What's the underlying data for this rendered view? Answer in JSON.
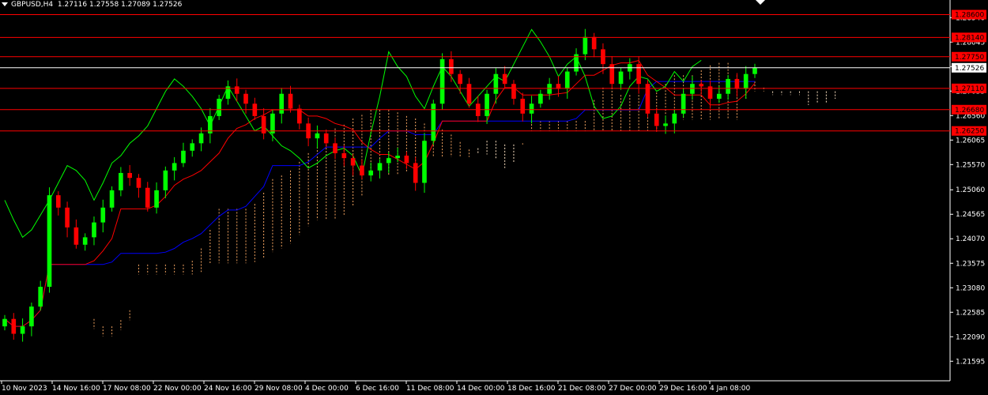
{
  "header": {
    "symbol": "GBPUSD,H4",
    "ohlc": "1.27116 1.27558 1.27089 1.27526"
  },
  "colors": {
    "background": "#000000",
    "axis": "#ffffff",
    "bull": "#00ff00",
    "bear": "#ff0000",
    "tenkan": "#ff0000",
    "kijun": "#0000ff",
    "chikou": "#00ff00",
    "cloud_a": "#f4a460",
    "cloud_b": "#ffe4c4",
    "level_line": "#ff0000",
    "level_label_bg": "#ff0000",
    "current_label_bg": "#ffffff"
  },
  "chart_data": {
    "type": "candlestick",
    "indicators": [
      "Ichimoku Kinko Hyo"
    ],
    "ylim": [
      1.212,
      1.288
    ],
    "y_ticks": [
      "1.28540",
      "1.28045",
      "1.27550",
      "1.27055",
      "1.26560",
      "1.26065",
      "1.25570",
      "1.25060",
      "1.24565",
      "1.24070",
      "1.23575",
      "1.23080",
      "1.22585",
      "1.22090",
      "1.21595"
    ],
    "x_labels": [
      "10 Nov 2023",
      "14 Nov 16:00",
      "17 Nov 08:00",
      "22 Nov 00:00",
      "24 Nov 16:00",
      "29 Nov 08:00",
      "4 Dec 00:00",
      "6 Dec 16:00",
      "11 Dec 08:00",
      "14 Dec 00:00",
      "18 Dec 16:00",
      "21 Dec 08:00",
      "27 Dec 00:00",
      "29 Dec 16:00",
      "4 Jan 08:00"
    ],
    "levels": [
      {
        "label": "1.28600",
        "value": 1.286
      },
      {
        "label": "1.28140",
        "value": 1.2814
      },
      {
        "label": "1.27750",
        "value": 1.2775
      },
      {
        "label": "1.27110",
        "value": 1.2711
      },
      {
        "label": "1.26680",
        "value": 1.2668
      },
      {
        "label": "1.26250",
        "value": 1.2625
      }
    ],
    "current_price": {
      "label": "1.27526",
      "value": 1.27526
    },
    "closes": [
      1.2245,
      1.2215,
      1.223,
      1.227,
      1.231,
      1.2495,
      1.247,
      1.243,
      1.2395,
      1.241,
      1.244,
      1.247,
      1.2505,
      1.254,
      1.253,
      1.251,
      1.247,
      1.2505,
      1.2545,
      1.256,
      1.2585,
      1.26,
      1.262,
      1.2655,
      1.269,
      1.2715,
      1.27,
      1.268,
      1.2655,
      1.262,
      1.266,
      1.27,
      1.267,
      1.264,
      1.261,
      1.262,
      1.26,
      1.258,
      1.257,
      1.2555,
      1.2535,
      1.2545,
      1.256,
      1.257,
      1.2575,
      1.256,
      1.252,
      1.2605,
      1.268,
      1.277,
      1.274,
      1.272,
      1.268,
      1.2655,
      1.27,
      1.274,
      1.272,
      1.269,
      1.266,
      1.268,
      1.27,
      1.272,
      1.271,
      1.2745,
      1.278,
      1.2815,
      1.279,
      1.276,
      1.272,
      1.2745,
      1.276,
      1.272,
      1.266,
      1.2635,
      1.264,
      1.266,
      1.27,
      1.272,
      1.2715,
      1.269,
      1.27,
      1.273,
      1.271,
      1.274,
      1.27526
    ]
  }
}
